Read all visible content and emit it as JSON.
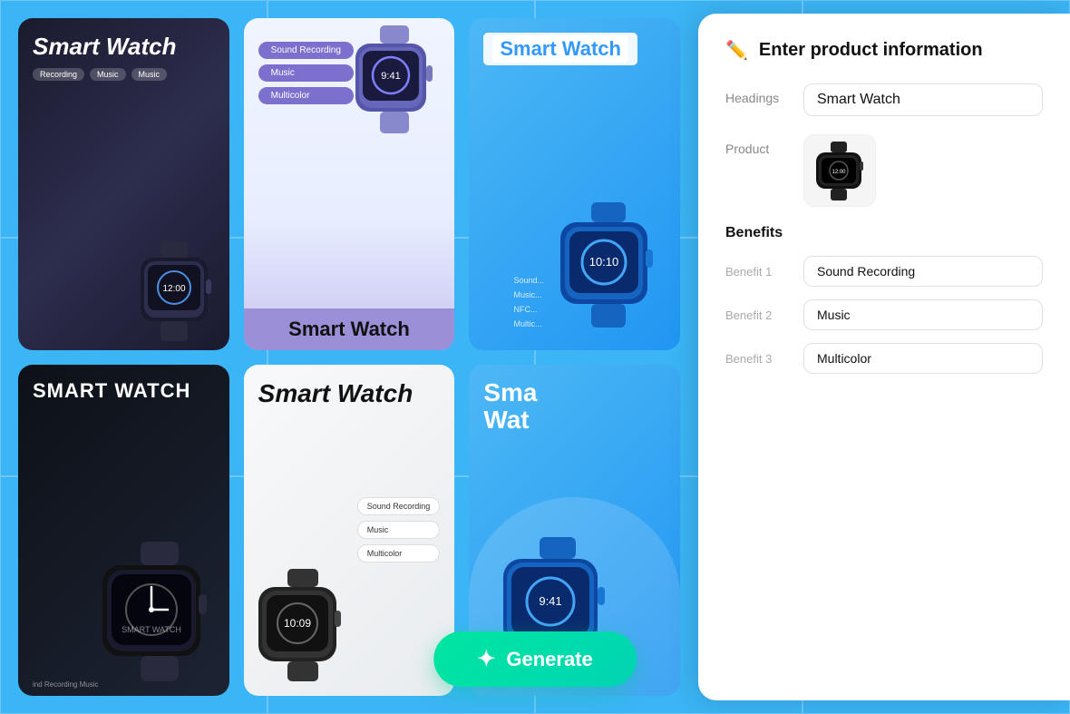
{
  "background": {
    "color": "#3bb5f5"
  },
  "cards": [
    {
      "id": "card-1",
      "theme": "dark",
      "title": "Smart Watch",
      "tags": [
        "Recording",
        "Music",
        "Music"
      ]
    },
    {
      "id": "card-2",
      "theme": "purple",
      "title": "Smart Watch",
      "benefits": [
        "Sound Recording",
        "Music",
        "Multicolor"
      ]
    },
    {
      "id": "card-3",
      "theme": "blue",
      "title": "Smart Watch",
      "sideText": [
        "Sound...",
        "Music...",
        "NFC...",
        "Multic..."
      ]
    },
    {
      "id": "card-4",
      "theme": "dark2",
      "title": "SMART WATCH",
      "subtitle": "ind Recording   Music"
    },
    {
      "id": "card-5",
      "theme": "light",
      "title": "Smart Watch",
      "benefits": [
        "Sound Recording",
        "Music",
        "Multicolor"
      ]
    },
    {
      "id": "card-6",
      "theme": "blue2",
      "title": "Sma\nWat"
    }
  ],
  "panel": {
    "title": "Enter product information",
    "icon": "✏️",
    "fields": {
      "headings_label": "Headings",
      "headings_value": "Smart Watch",
      "product_label": "Product",
      "benefits_title": "Benefits",
      "benefit1_label": "Benefit 1",
      "benefit1_value": "Sound Recording",
      "benefit2_label": "Benefit 2",
      "benefit2_value": "Music",
      "benefit3_label": "Benefit 3",
      "benefit3_value": "Multicolor"
    }
  },
  "generate_button": {
    "label": "Generate",
    "icon": "✦"
  }
}
